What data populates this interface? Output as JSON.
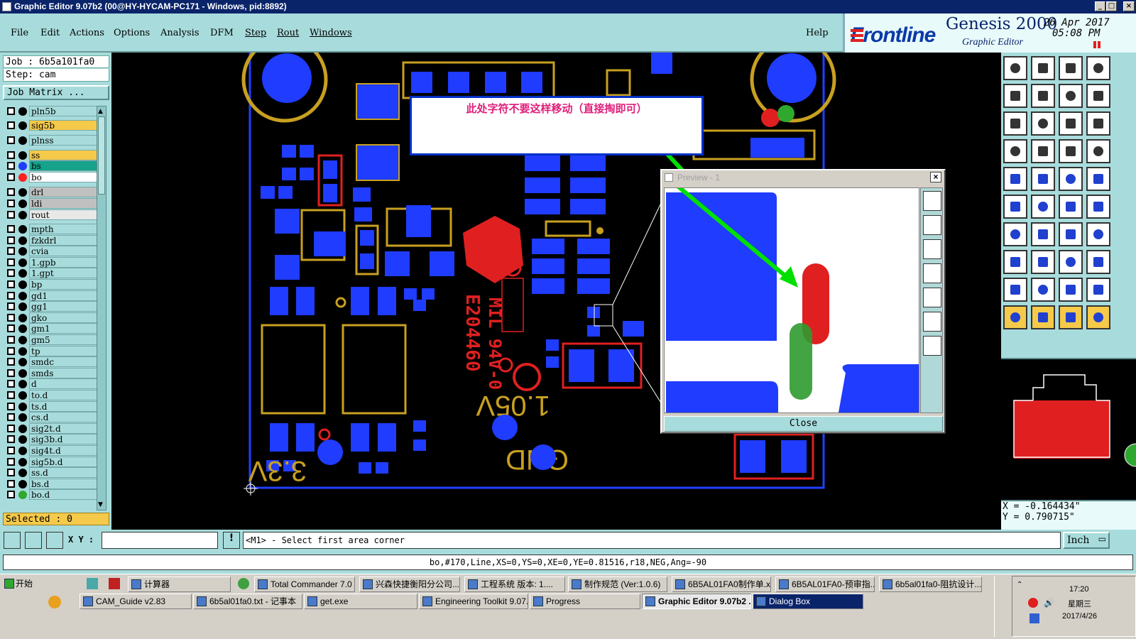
{
  "window": {
    "title": "Graphic Editor 9.07b2 (00@HY-HYCAM-PC171 - Windows, pid:8892)"
  },
  "menu": {
    "items": [
      "File",
      "Edit",
      "Actions",
      "Options",
      "Analysis",
      "DFM",
      "Step",
      "Rout",
      "Windows"
    ],
    "help": "Help"
  },
  "brand": {
    "logo": "Frontline",
    "product": "Genesis 2000",
    "subtitle": "Graphic Editor",
    "date": "26 Apr 2017",
    "time": "05:08 PM"
  },
  "job": {
    "job_label": "Job : 6b5a101fa0",
    "step_label": "Step: cam",
    "matrix_button": "Job Matrix ..."
  },
  "layers": [
    {
      "name": "pln5b",
      "color": "#a8dcdc",
      "dot": ""
    },
    {
      "name": "sig5b",
      "color": "#f5c94a",
      "dot": ""
    },
    {
      "name": "plnss",
      "color": "#a8dcdc",
      "dot": ""
    },
    {
      "name": "ss",
      "color": "#f5c94a",
      "dot": ""
    },
    {
      "name": "bs",
      "color": "#17a28c",
      "dot": "#1f3cff"
    },
    {
      "name": "bo",
      "color": "#ffffff",
      "dot": "#ff2020"
    },
    {
      "name": "drl",
      "color": "#c0c0c0",
      "dot": ""
    },
    {
      "name": "ldi",
      "color": "#c0c0c0",
      "dot": ""
    },
    {
      "name": "rout",
      "color": "#e8e8e8",
      "dot": ""
    },
    {
      "name": "mpth",
      "color": "#a8dcdc",
      "dot": ""
    },
    {
      "name": "fzkdrl",
      "color": "#a8dcdc",
      "dot": ""
    },
    {
      "name": "cvia",
      "color": "#a8dcdc",
      "dot": ""
    },
    {
      "name": "1.gpb",
      "color": "#a8dcdc",
      "dot": ""
    },
    {
      "name": "1.gpt",
      "color": "#a8dcdc",
      "dot": ""
    },
    {
      "name": "bp",
      "color": "#a8dcdc",
      "dot": ""
    },
    {
      "name": "gd1",
      "color": "#a8dcdc",
      "dot": ""
    },
    {
      "name": "gg1",
      "color": "#a8dcdc",
      "dot": ""
    },
    {
      "name": "gko",
      "color": "#a8dcdc",
      "dot": ""
    },
    {
      "name": "gm1",
      "color": "#a8dcdc",
      "dot": ""
    },
    {
      "name": "gm5",
      "color": "#a8dcdc",
      "dot": ""
    },
    {
      "name": "tp",
      "color": "#a8dcdc",
      "dot": ""
    },
    {
      "name": "smdc",
      "color": "#a8dcdc",
      "dot": ""
    },
    {
      "name": "smds",
      "color": "#a8dcdc",
      "dot": ""
    },
    {
      "name": "d",
      "color": "#a8dcdc",
      "dot": ""
    },
    {
      "name": "to.d",
      "color": "#a8dcdc",
      "dot": ""
    },
    {
      "name": "ts.d",
      "color": "#a8dcdc",
      "dot": ""
    },
    {
      "name": "cs.d",
      "color": "#a8dcdc",
      "dot": ""
    },
    {
      "name": "sig2t.d",
      "color": "#a8dcdc",
      "dot": ""
    },
    {
      "name": "sig3b.d",
      "color": "#a8dcdc",
      "dot": ""
    },
    {
      "name": "sig4t.d",
      "color": "#a8dcdc",
      "dot": ""
    },
    {
      "name": "sig5b.d",
      "color": "#a8dcdc",
      "dot": ""
    },
    {
      "name": "ss.d",
      "color": "#a8dcdc",
      "dot": ""
    },
    {
      "name": "bs.d",
      "color": "#a8dcdc",
      "dot": ""
    },
    {
      "name": "bo.d",
      "color": "#a8dcdc",
      "dot": "#2fa82f"
    }
  ],
  "selected": "Selected : 0",
  "note": {
    "text": "此处字符不要这样移动（直接掏即可）"
  },
  "preview": {
    "title": "Preview - 1",
    "close": "Close"
  },
  "silk": {
    "v105": "1.05V",
    "v33": "3.3V",
    "gnd": "GND",
    "code": "E204460",
    "mil": "MIL 94V-0"
  },
  "coords": {
    "x": "X = -0.164434\"",
    "y": "Y = 0.790715\""
  },
  "units": "Inch",
  "bottom": {
    "xy_label": "X Y :",
    "prompt": "<M1> - Select first area corner"
  },
  "status": "bo,#170,Line,XS=0,YS=0,XE=0,YE=0.81516,r18,NEG,Ang=-90",
  "taskbar": {
    "start": "开始",
    "row1": [
      "计算器",
      "Total Commander 7.0 ...",
      "兴森快捷衡阳分公司...",
      "工程系统  版本: 1....",
      "制作规范 (Ver:1.0.6)",
      "6B5AL01FA0制作单.x...",
      "6B5AL01FA0-预审指...",
      "6b5al01fa0-阻抗设计..."
    ],
    "row2": [
      "CAM_Guide v2.83",
      "6b5al01fa0.txt - 记事本",
      "get.exe",
      "Engineering Toolkit 9.07...",
      "Progress",
      "Graphic Editor 9.07b2 ...",
      "Dialog Box"
    ],
    "clock_time": "17:20",
    "clock_day": "星期三",
    "clock_date": "2017/4/26"
  },
  "colors": {
    "pad": "#1f3cff",
    "silk": "#e02020",
    "outline": "#c8a020",
    "board_line": "#2040ff",
    "arrow": "#00e000"
  }
}
